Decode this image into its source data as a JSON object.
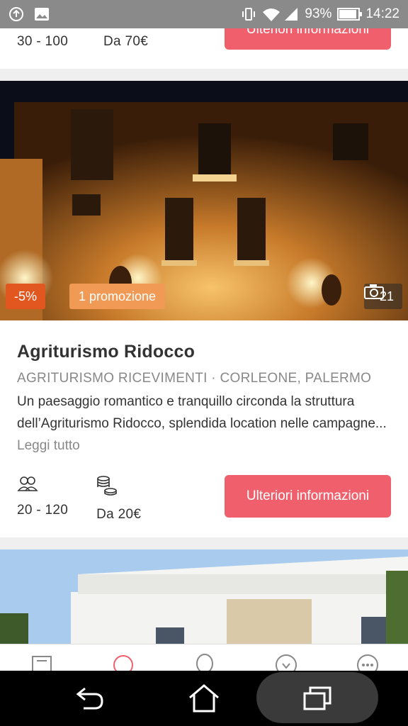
{
  "status_bar": {
    "battery_percent": "93%",
    "battery_level": 0.93,
    "time": "14:22",
    "icons": [
      "upload-icon",
      "image-icon",
      "vibrate-icon",
      "wifi-icon",
      "signal-icon",
      "battery-icon"
    ]
  },
  "previous_card": {
    "capacity": "30 - 100",
    "price": "Da 70€",
    "button_label": "Ulteriori informazioni"
  },
  "card": {
    "discount_badge": "-5%",
    "promo_badge": "1 promozione",
    "photo_count": "21",
    "title": "Agriturismo Ridocco",
    "subtitle": "AGRITURISMO RICEVIMENTI · CORLEONE, PALERMO",
    "description": "Un paesaggio romantico e tranquillo circonda la struttura dell’Agriturismo Ridocco, splendida location nelle campagne...",
    "read_more": "Leggi tutto",
    "capacity": "20 - 120",
    "price": "Da 20€",
    "button_label": "Ulteriori informazioni"
  },
  "colors": {
    "accent": "#f0606c",
    "discount": "#e2571f",
    "promo": "#f19a55"
  },
  "tabbar": {
    "icons": [
      "notebook-icon",
      "ring-icon",
      "balloon-icon",
      "heart-check-icon",
      "more-icon"
    ]
  },
  "navbar": {
    "icons": [
      "back-icon",
      "home-icon",
      "recent-apps-icon"
    ]
  }
}
